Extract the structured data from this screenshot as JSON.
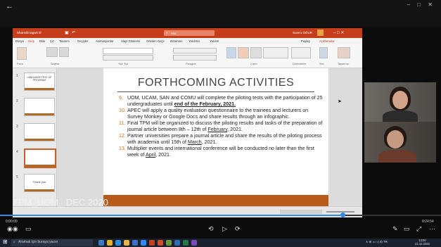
{
  "window": {
    "controls": "–  □  ✕"
  },
  "ppt": {
    "file_name": "Sharedit tagwn kl",
    "search_placeholder": "Ara",
    "user_name": "Sumru OĞUR",
    "share_label": "Paylaş",
    "comments_label": "Açıklamalar",
    "tabs": [
      "Dosya",
      "Giriş",
      "Ekle",
      "Çiz",
      "Tasarım",
      "Geçişler",
      "Animasyonlar",
      "Slayt Gösterisi",
      "Gözden Geçir",
      "Görünüm",
      "Yardımcı",
      "Yardım"
    ],
    "groups": [
      "Pano",
      "Slaytlar",
      "Yazı Tipi",
      "Paragraf",
      "Çizim",
      "Düzenleme",
      "Ses",
      "Tasarımcı"
    ]
  },
  "thumbnails": [
    {
      "num": "1",
      "text": "LANGUAGE TEXT OF PROGRAM"
    },
    {
      "num": "2",
      "text": ""
    },
    {
      "num": "3",
      "text": ""
    },
    {
      "num": "4",
      "text": ""
    },
    {
      "num": "5",
      "text": "Thank you"
    }
  ],
  "slide": {
    "title": "FORTHCOMING ACTIVITIES",
    "bullets": [
      {
        "num": "9.",
        "text": "UOM, UCAM, SAN and COMU will complete the piloting tests with the participation of 25 undergraduates until ",
        "em": "end of the February, 2021."
      },
      {
        "num": "10.",
        "text": "APEC will apply a quality evaluation questionnaire to the trainees and lecturers on Survey Monkey or Google Docs and share results through an infographic.",
        "em": ""
      },
      {
        "num": "11.",
        "text": "Final TPM will be organized to discuss the piloting results and tasks of the preparation of journal article between 8th – 12th of ",
        "em": "February",
        "tail": ", 2021."
      },
      {
        "num": "12.",
        "text": "Partner universities prepare a journal article and share the results of the piloting process with academia until 15th of ",
        "em": "March",
        "tail": ", 2021."
      },
      {
        "num": "13.",
        "text": "Multiplier events and international conference will be conducted no later than the first week of ",
        "em": "April",
        "tail": ", 2021."
      }
    ]
  },
  "watermark": "TPM_UOM_ DEC 2020",
  "meeting": {
    "elapsed": "0:00:00",
    "remaining": "0:24:54"
  },
  "taskbar": {
    "search_text": "Aramak için buraya yazın",
    "tray": "∧ ⊕ ▭ ◁ 4) TR",
    "clock_time": "13:00",
    "clock_date": "21.12.2020"
  }
}
